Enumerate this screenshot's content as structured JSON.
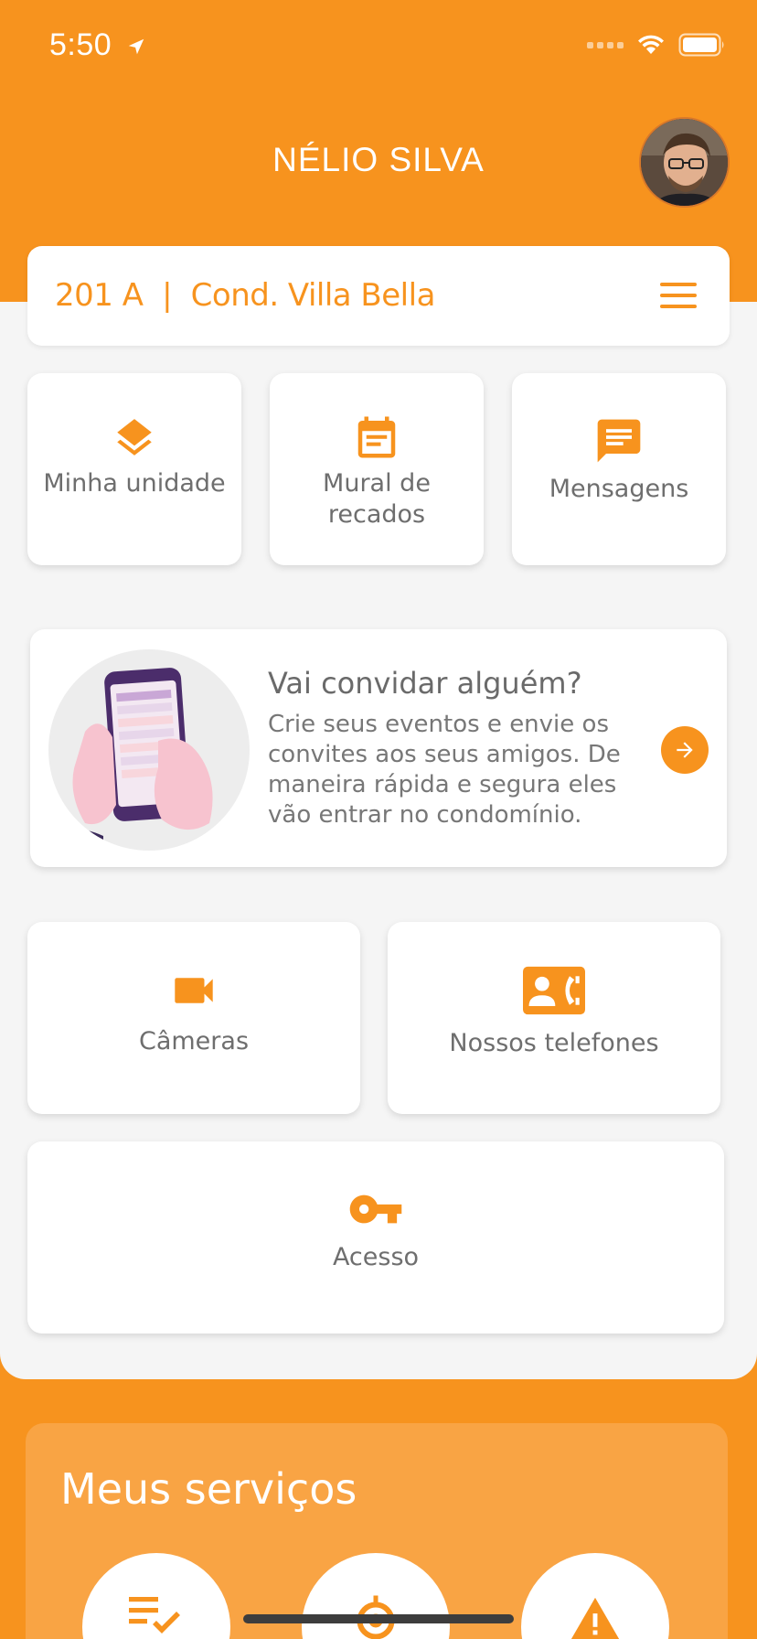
{
  "status_bar": {
    "time": "5:50"
  },
  "header": {
    "user_name": "NÉLIO SILVA"
  },
  "unit": {
    "title": "201 A  |  Cond. Villa Bella"
  },
  "quick_actions": [
    {
      "label": "Minha unidade",
      "icon": "layers-icon"
    },
    {
      "label": "Mural de recados",
      "icon": "calendar-icon"
    },
    {
      "label": "Mensagens",
      "icon": "message-icon"
    }
  ],
  "invite": {
    "title": "Vai convidar alguém?",
    "text": "Crie seus eventos e envie os convites aos seus amigos. De maneira rápida e segura eles vão entrar no condomínio."
  },
  "secondary_actions": [
    {
      "label": "Câmeras",
      "icon": "videocam-icon"
    },
    {
      "label": "Nossos telefones",
      "icon": "contact-phone-icon"
    },
    {
      "label": "Acesso",
      "icon": "key-icon"
    }
  ],
  "services": {
    "title": "Meus serviços",
    "items": [
      {
        "icon": "checklist-icon"
      },
      {
        "icon": "location-target-icon"
      },
      {
        "icon": "warning-icon"
      }
    ]
  },
  "colors": {
    "accent": "#f7931e",
    "services_bg": "#f9a444",
    "background": "#f5f5f5"
  }
}
